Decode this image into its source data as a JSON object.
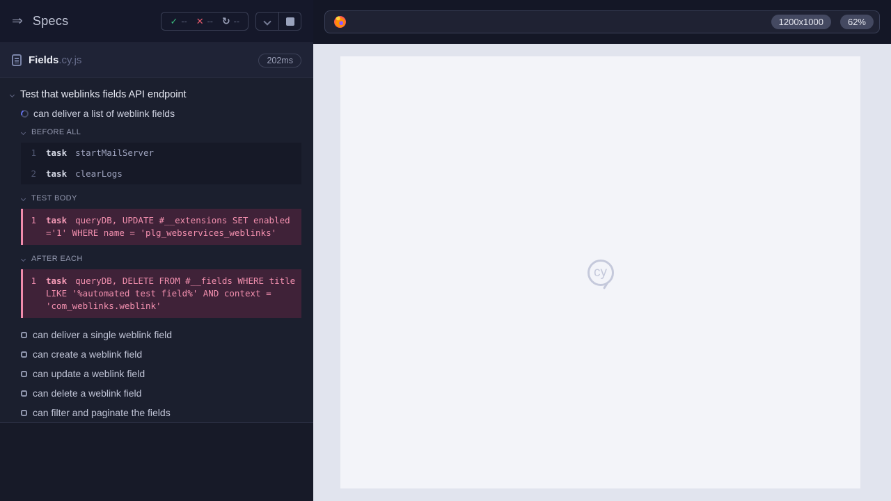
{
  "sidebar": {
    "title": "Specs",
    "stats": {
      "passed": "--",
      "failed": "--",
      "running": "--"
    },
    "controls": {
      "collapse_icon": "chevron-down-icon",
      "stop_icon": "stop-square-icon"
    },
    "spec_file": {
      "name": "Fields",
      "ext": ".cy.js",
      "duration": "202ms"
    },
    "suite": {
      "title": "Test that weblinks fields API endpoint",
      "running_test": "can deliver a list of weblink fields",
      "sections": [
        {
          "label": "BEFORE ALL",
          "commands": [
            {
              "num": "1",
              "method": "task",
              "message": "startMailServer"
            },
            {
              "num": "2",
              "method": "task",
              "message": "clearLogs"
            }
          ]
        },
        {
          "label": "TEST BODY",
          "commands": [
            {
              "num": "1",
              "method": "task",
              "message": "queryDB, UPDATE #__extensions SET enabled ='1' WHERE name = 'plg_webservices_weblinks'"
            }
          ]
        },
        {
          "label": "AFTER EACH",
          "commands": [
            {
              "num": "1",
              "method": "task",
              "message": "queryDB, DELETE FROM #__fields WHERE title LIKE '%automated test field%' AND context = 'com_weblinks.weblink'"
            }
          ]
        }
      ],
      "pending_tests": [
        "can deliver a single weblink field",
        "can create a weblink field",
        "can update a weblink field",
        "can delete a weblink field",
        "can filter and paginate the fields"
      ]
    }
  },
  "main": {
    "browser_icon": "firefox-icon",
    "viewport_size": "1200x1000",
    "zoom_level": "62%",
    "watermark": "cy"
  },
  "colors": {
    "accent_pink": "#f18bac",
    "pass_green": "#3aba7c",
    "fail_red": "#e4596b",
    "running_indigo": "#6673f0",
    "viewport_bg": "#f3f4f9",
    "stage_bg": "#e1e4ee"
  }
}
